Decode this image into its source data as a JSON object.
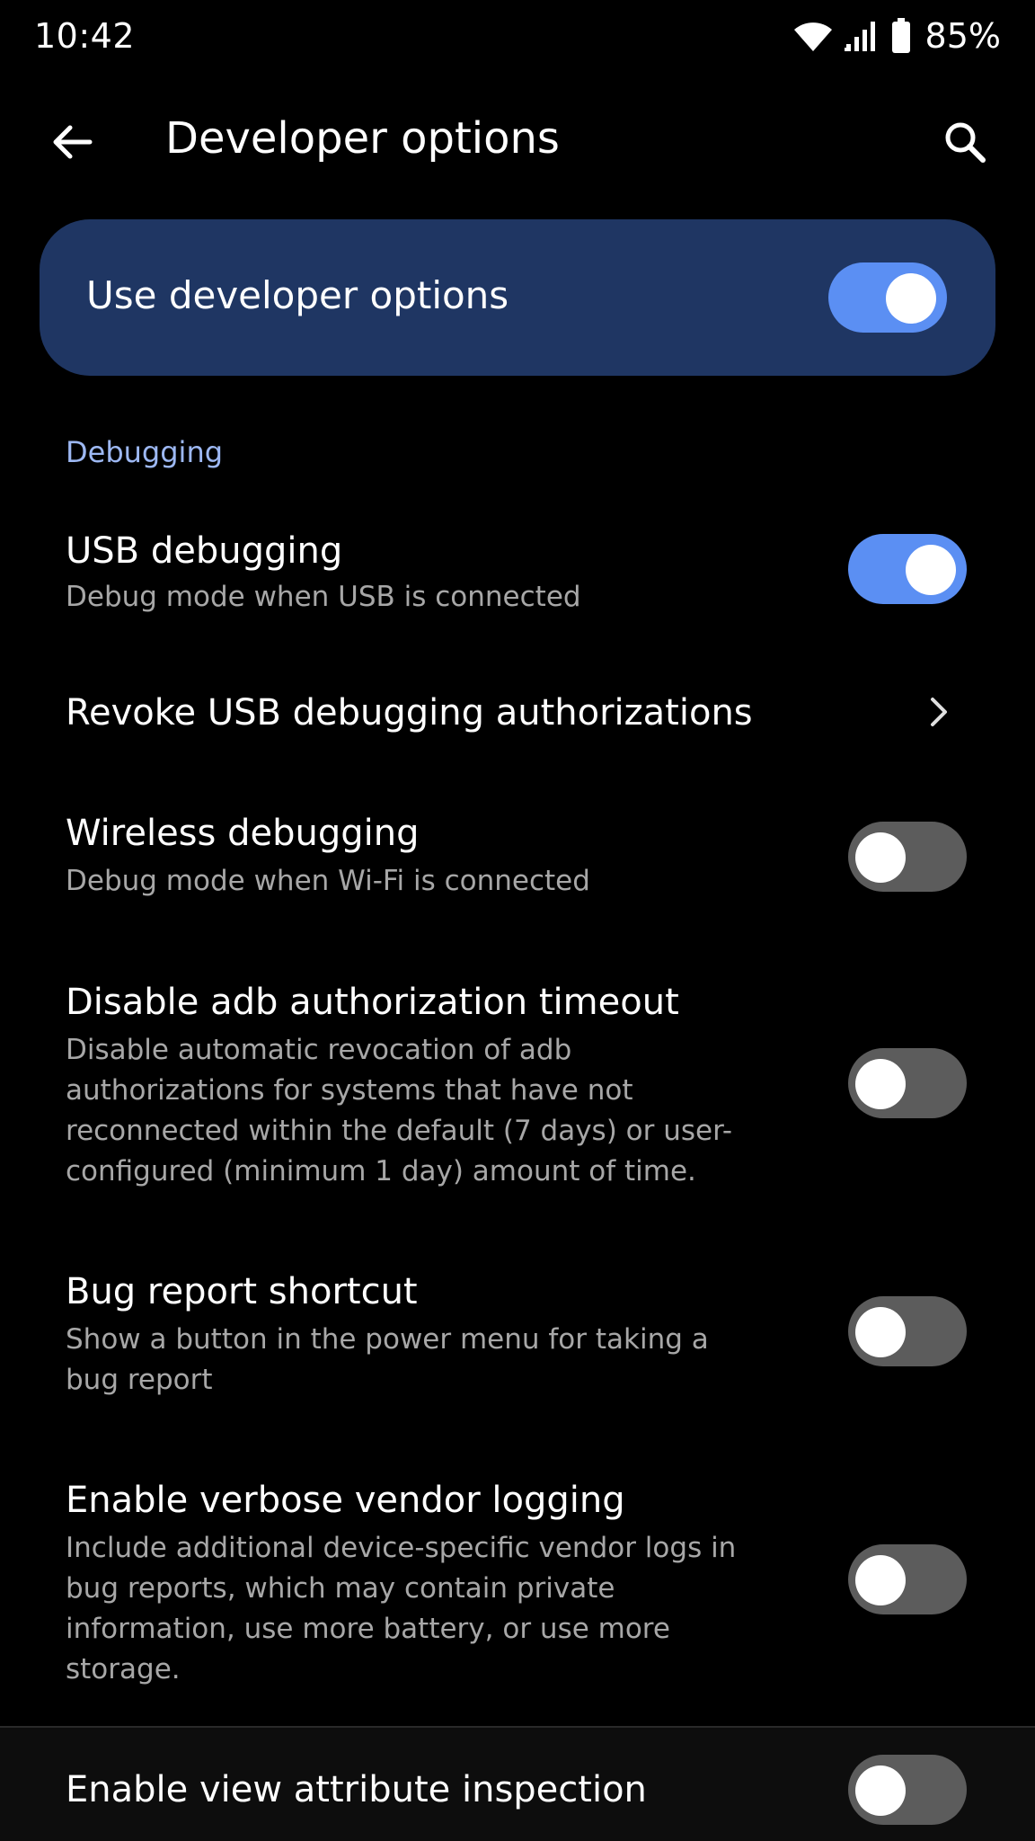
{
  "status_bar": {
    "time": "10:42",
    "battery_percent": "85%",
    "icons": [
      "wifi-icon",
      "cellular-signal-icon",
      "battery-icon"
    ]
  },
  "app_bar": {
    "title": "Developer options",
    "back_icon": "arrow-back-icon",
    "search_icon": "search-icon"
  },
  "master_switch": {
    "label": "Use developer options",
    "checked": true
  },
  "section": {
    "title": "Debugging"
  },
  "preferences": [
    {
      "title": "USB debugging",
      "summary": "Debug mode when USB is connected",
      "control": "toggle",
      "checked": true
    },
    {
      "title": "Revoke USB debugging authorizations",
      "summary": "",
      "control": "chevron"
    },
    {
      "title": "Wireless debugging",
      "summary": "Debug mode when Wi-Fi is connected",
      "control": "toggle",
      "checked": false
    },
    {
      "title": "Disable adb authorization timeout",
      "summary": "Disable automatic revocation of adb authorizations for systems that have not reconnected within the default (7 days) or user-configured (minimum 1 day) amount of time.",
      "control": "toggle",
      "checked": false
    },
    {
      "title": "Bug report shortcut",
      "summary": "Show a button in the power menu for taking a bug report",
      "control": "toggle",
      "checked": false
    },
    {
      "title": "Enable verbose vendor logging",
      "summary": "Include additional device-specific vendor logs in bug reports, which may contain private information, use more battery, or use more storage.",
      "control": "toggle",
      "checked": false
    },
    {
      "title": "Enable view attribute inspection",
      "summary": "",
      "control": "toggle",
      "checked": false
    }
  ],
  "colors": {
    "background": "#000000",
    "card": "#1f3663",
    "accent": "#5b8ff3",
    "section_header": "#9db8f3",
    "summary_text": "#a7a7a7",
    "toggle_off_track": "#5c5c5c"
  }
}
